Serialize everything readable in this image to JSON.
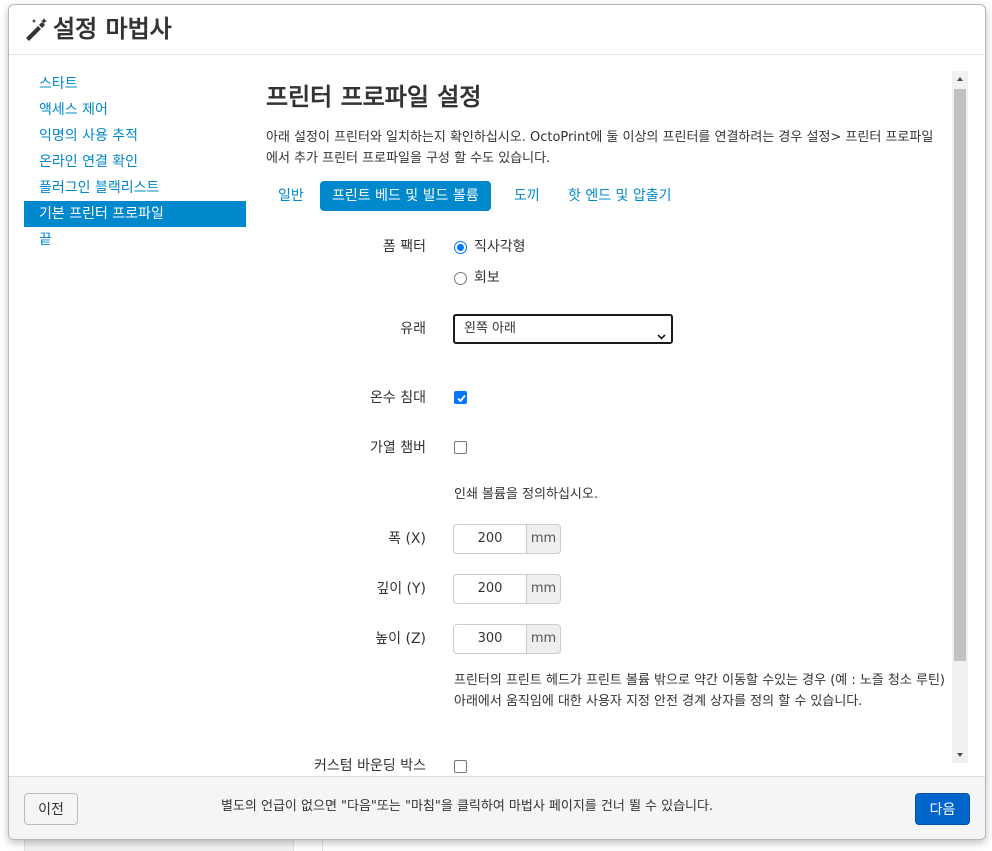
{
  "header": {
    "title": "설정 마법사",
    "icon": "magic-wand-icon"
  },
  "sidebar": {
    "items": [
      {
        "label": "스타트",
        "active": false
      },
      {
        "label": "액세스 제어",
        "active": false
      },
      {
        "label": "익명의 사용 추적",
        "active": false
      },
      {
        "label": "온라인 연결 확인",
        "active": false
      },
      {
        "label": "플러그인 블랙리스트",
        "active": false
      },
      {
        "label": "기본 프린터 프로파일",
        "active": true
      },
      {
        "label": "끝",
        "active": false
      }
    ]
  },
  "main": {
    "title": "프린터 프로파일 설정",
    "intro": "아래 설정이 프린터와 일치하는지 확인하십시오. OctoPrint에 둘 이상의 프린터를 연결하려는 경우 설정> 프린터 프로파일에서 추가 프린터 프로파일을 구성 할 수도 있습니다.",
    "tabs": [
      {
        "label": "일반",
        "active": false
      },
      {
        "label": "프린트 베드 및 빌드 볼륨",
        "active": true
      },
      {
        "label": "도끼",
        "active": false
      },
      {
        "label": "핫 엔드 및 압출기",
        "active": false
      }
    ],
    "form": {
      "form_factor_label": "폼 팩터",
      "form_factor_options": [
        {
          "label": "직사각형",
          "checked": true
        },
        {
          "label": "회보",
          "checked": false
        }
      ],
      "origin_label": "유래",
      "origin_value": "왼쪽 아래",
      "heated_bed_label": "온수 침대",
      "heated_bed_checked": true,
      "heated_chamber_label": "가열 챔버",
      "heated_chamber_checked": false,
      "volume_help": "인쇄 볼륨을 정의하십시오.",
      "width_label": "폭 (X)",
      "width_value": "200",
      "depth_label": "깊이 (Y)",
      "depth_value": "200",
      "height_label": "높이 (Z)",
      "height_value": "300",
      "unit": "mm",
      "bounding_help": "프린터의 프린트 헤드가 프린트 볼륨 밖으로 약간 이동할 수있는 경우 (예 : 노즐 청소 루틴) 아래에서 움직임에 대한 사용자 지정 안전 경계 상자를 정의 할 수 있습니다.",
      "custom_box_label": "커스텀 바운딩 박스"
    }
  },
  "footer": {
    "prev_label": "이전",
    "hint": "별도의 언급이 없으면 \"다음\"또는 \"마침\"을 클릭하여 마법사 페이지를 건너 뛸 수 있습니다.",
    "next_label": "다음"
  },
  "colors": {
    "accent": "#0088cc",
    "primary_button": "#0066cc",
    "checkbox": "#0075ff"
  }
}
